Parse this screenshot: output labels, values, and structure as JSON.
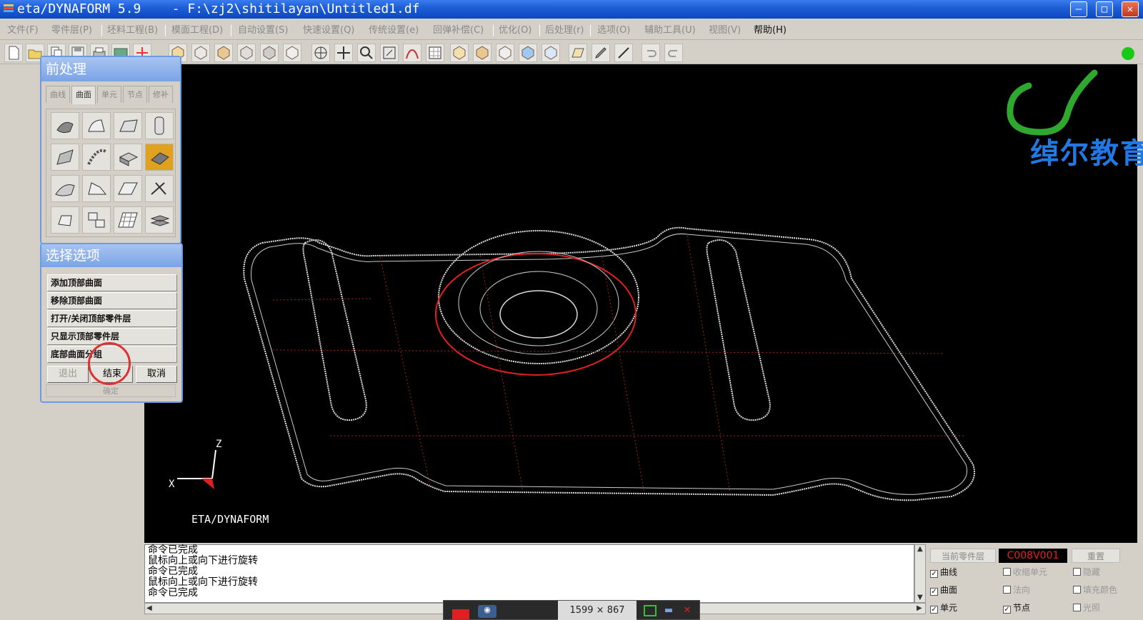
{
  "window": {
    "title": "eta/DYNAFORM 5.9    - F:\\zj2\\shitilayan\\Untitled1.df",
    "min_label": "‒",
    "max_label": "□",
    "close_label": "✕"
  },
  "menu": {
    "items": [
      "文件(F)",
      "零件层(P)",
      "坯料工程(B)",
      "模面工程(D)",
      "自动设置(S)",
      "快速设置(Q)",
      "传统设置(e)",
      "回弹补偿(C)",
      "优化(O)",
      "后处理(r)",
      "选项(O)",
      "辅助工具(U)",
      "视图(V)",
      "帮助(H)"
    ]
  },
  "preprocess": {
    "title": "前处理",
    "tabs": [
      "曲线",
      "曲面",
      "单元",
      "节点",
      "修补"
    ],
    "active_tab": 1
  },
  "select_options": {
    "title": "选择选项",
    "options": [
      "添加顶部曲面",
      "移除顶部曲面",
      "打开/关闭顶部零件层",
      "只显示顶部零件层",
      "底部曲面分组"
    ],
    "exit_label": "退出",
    "finish_label": "结束",
    "cancel_label": "取消",
    "confirm_label": "确定"
  },
  "viewport": {
    "logo_text": "绰尔教育",
    "brand": "ETA/DYNAFORM",
    "axis_x": "X",
    "axis_z": "Z"
  },
  "console": {
    "lines": [
      "命令已完成",
      "鼠标向上或向下进行旋转",
      "命令已完成",
      "鼠标向上或向下进行旋转",
      "命令已完成"
    ]
  },
  "recorder": {
    "size": "1599 × 867"
  },
  "props": {
    "current_part_label": "当前零件层",
    "part_name": "C008V001",
    "reset_label": "重置",
    "checkboxes": [
      {
        "label": "曲线",
        "checked": true
      },
      {
        "label": "收缩单元",
        "checked": false
      },
      {
        "label": "隐藏",
        "checked": false
      },
      {
        "label": "曲面",
        "checked": true
      },
      {
        "label": "法向",
        "checked": false
      },
      {
        "label": "填充颜色",
        "checked": false
      },
      {
        "label": "单元",
        "checked": true
      },
      {
        "label": "节点",
        "checked": true
      },
      {
        "label": "光照",
        "checked": false
      }
    ]
  },
  "colors": {
    "titlebar": "#0b47c2",
    "viewport_bg": "#000000",
    "logo": "#1f7ae6",
    "logo_arc": "#2fa82f",
    "model_line": "#ffffff",
    "red_line": "#e02020",
    "status_dot": "#18c918"
  }
}
